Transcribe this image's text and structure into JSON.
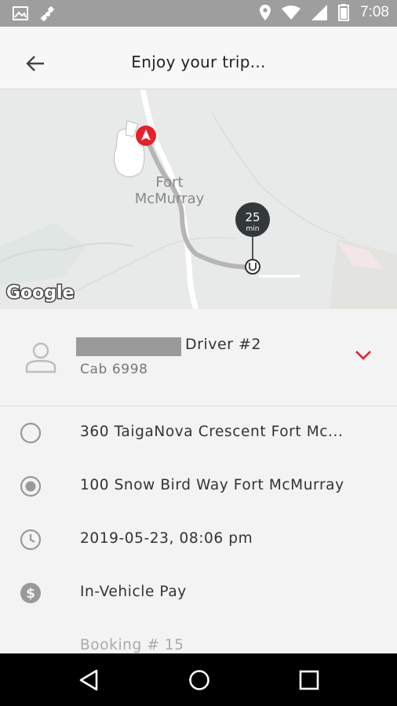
{
  "status_bar": {
    "time": "7:08",
    "left_icons": [
      "image-icon",
      "satellite-icon"
    ],
    "right_icons": [
      "location-icon",
      "wifi-icon",
      "signal-icon",
      "battery-icon"
    ]
  },
  "app_bar": {
    "title": "Enjoy your trip...",
    "back_icon": "arrow-left-icon"
  },
  "map": {
    "city_label_1": "Fort",
    "city_label_2": "McMurray",
    "eta_value": "25",
    "eta_unit": "min",
    "attribution": "Google",
    "route_color": "#b5b5b5",
    "pickup_marker_color": "#e8202a"
  },
  "driver": {
    "name": "Driver #2",
    "cab": "Cab 6998",
    "expand_icon": "chevron-down-icon",
    "accent": "#e8202a"
  },
  "trip": {
    "pickup": "360 TaigaNova Crescent Fort Mc...",
    "dropoff": "100 Snow Bird Way Fort McMurray",
    "datetime": "2019-05-23, 08:06 pm",
    "payment": "In-Vehicle Pay",
    "booking": "Booking # 15"
  },
  "nav_bar": {
    "icons": [
      "back-triangle-icon",
      "home-circle-icon",
      "recents-square-icon"
    ]
  }
}
